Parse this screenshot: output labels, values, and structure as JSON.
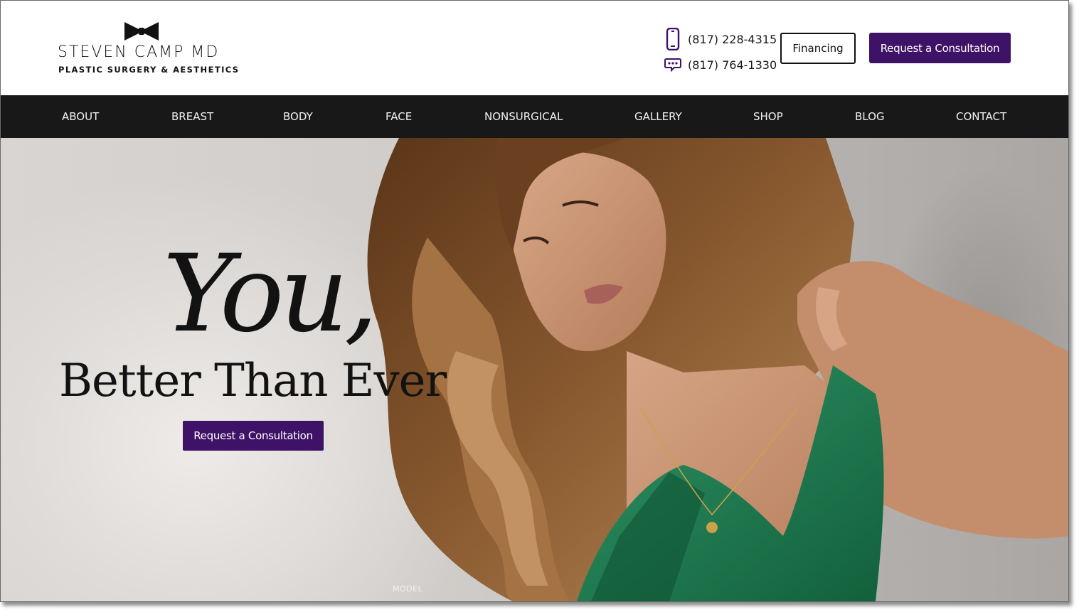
{
  "brand": {
    "name": "STEVEN CAMP MD",
    "tagline": "PLASTIC SURGERY & AESTHETICS",
    "logo_icon": "bow-tie-icon"
  },
  "contact": {
    "phone_primary": "(817) 228-4315",
    "phone_primary_icon": "mobile-phone-icon",
    "phone_text": "(817) 764-1330",
    "phone_text_icon": "chat-bubble-icon"
  },
  "header_buttons": {
    "financing_label": "Financing",
    "request_label": "Request a Consultation"
  },
  "nav": {
    "items": [
      {
        "label": "ABOUT"
      },
      {
        "label": "BREAST"
      },
      {
        "label": "BODY"
      },
      {
        "label": "FACE"
      },
      {
        "label": "NONSURGICAL"
      },
      {
        "label": "GALLERY"
      },
      {
        "label": "SHOP"
      },
      {
        "label": "BLOG"
      },
      {
        "label": "CONTACT"
      }
    ]
  },
  "hero": {
    "headline": "You,",
    "subheadline": "Better Than Ever",
    "cta_label": "Request a Consultation",
    "image_caption": "MODEL"
  },
  "colors": {
    "accent_purple": "#3e1266",
    "nav_background": "#181818",
    "dress_green": "#1c7a4e",
    "hair_brown": "#7a4a26"
  }
}
